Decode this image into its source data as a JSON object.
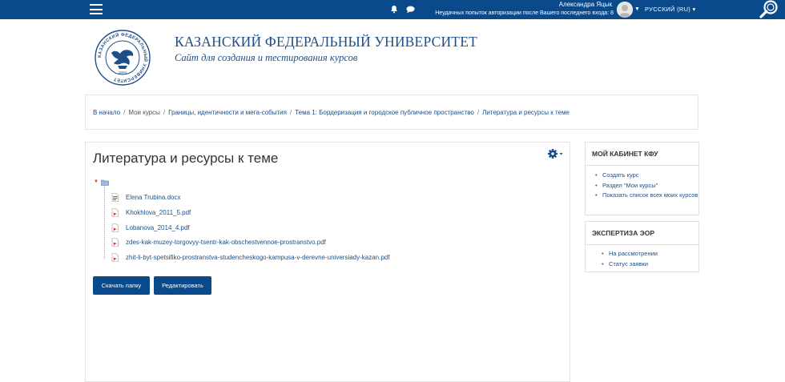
{
  "header": {
    "user_name": "Александра Яцык",
    "login_note": "Неудачных попыток авторизации после Вашего последнего входа: 8",
    "language": "РУССКИЙ (RU)",
    "icons": [
      "menu-icon",
      "bell-icon",
      "chat-icon",
      "user-avatar",
      "search-icon"
    ]
  },
  "branding": {
    "title": "КАЗАНСКИЙ ФЕДЕРАЛЬНЫЙ УНИВЕРСИТЕТ",
    "subtitle": "Сайт для создания и тестирования курсов",
    "logo_text": "КАЗАНСКИЙ ФЕДЕРАЛЬНЫЙ УНИВЕРСИТЕТ",
    "logo_year": "1804"
  },
  "breadcrumb": [
    "В начало",
    "Мои курсы",
    "Границы, идентичности и мега-события",
    "Тема 1: Бордеризация и городское публичное пространство",
    "Литература и ресурсы к теме"
  ],
  "page": {
    "title": "Литература и ресурсы к теме",
    "files": [
      {
        "name": "Elena Trubina.docx",
        "type": "docx"
      },
      {
        "name": "Khokhlova_2011_5.pdf",
        "type": "pdf"
      },
      {
        "name": "Lobanova_2014_4.pdf",
        "type": "pdf"
      },
      {
        "name": "zdes-kak-muzey-torgovyy-tsentr-kak-obschestvennoe-prostranstvo.pdf",
        "type": "pdf"
      },
      {
        "name": "zhit-li-byt-spetsifiko-prostranstva-studencheskogo-kampusa-v-derevne-universiady-kazan.pdf",
        "type": "pdf"
      }
    ],
    "download_button": "Скачать папку",
    "edit_button": "Редактировать"
  },
  "sidebar": {
    "block1": {
      "title": "МОЙ КАБИНЕТ КФУ",
      "items": [
        "Создать курс",
        "Раздел \"Мои курсы\"",
        "Показать список всех моих курсов"
      ]
    },
    "block2": {
      "title": "ЭКСПЕРТИЗА ЭОР",
      "items": [
        "На рассмотрении",
        "Статус заявки"
      ]
    }
  },
  "colors": {
    "topbar": "#0a4a8a",
    "brand": "#1d4f86",
    "pdf_icon": "#d9261c"
  }
}
